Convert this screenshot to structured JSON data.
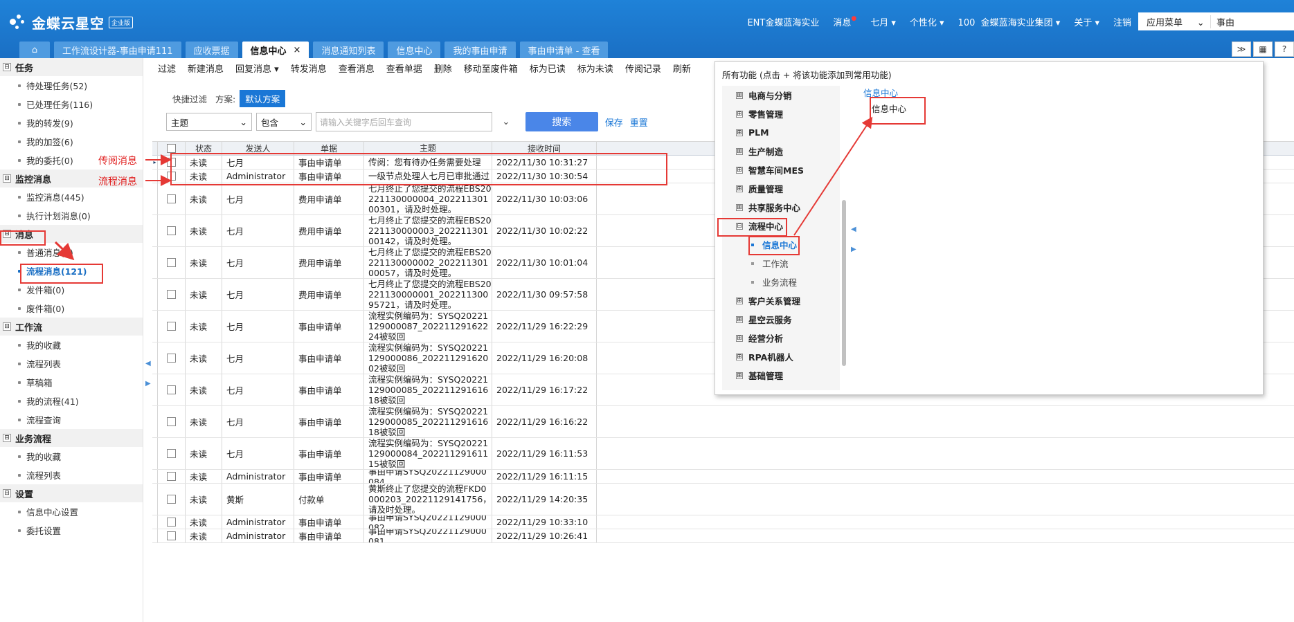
{
  "app": {
    "brand": "金蝶云星空",
    "edition": "企业版"
  },
  "topnav": {
    "org": "ENT金蝶蓝海实业",
    "messages": "消息",
    "user": "七月 ▾",
    "personalize": "个性化 ▾",
    "org_id": "100",
    "group": "金蝶蓝海实业集团 ▾",
    "about": "关于 ▾",
    "logout": "注销"
  },
  "appmenu": {
    "label": "应用菜单",
    "chevron": "⌄",
    "value": "事由"
  },
  "tabs": [
    "工作流设计器-事由申请111",
    "应收票据",
    "信息中心",
    "消息通知列表",
    "信息中心",
    "我的事由申请",
    "事由申请单 - 查看"
  ],
  "tab_close": "×",
  "icons": {
    "home": "home-icon",
    "collapse": "double-chevron-icon",
    "grid": "grid-icon",
    "help": "help-icon",
    "chevron": "chevron-down-icon"
  },
  "glyphs": {
    "collapse": "≫",
    "grid": "▦",
    "help": "?",
    "split_left": "◀",
    "split_right": "▶",
    "row_marker": "▸",
    "dbl_arrow": "⌄"
  },
  "sidebar": {
    "sections": [
      {
        "title": "任务",
        "toggle": "⊟",
        "items": [
          {
            "label": "待处理任务(52)"
          },
          {
            "label": "已处理任务(116)"
          },
          {
            "label": "我的转发(9)"
          },
          {
            "label": "我的加签(6)"
          },
          {
            "label": "我的委托(0)"
          }
        ]
      },
      {
        "title": "监控消息",
        "toggle": "⊟",
        "items": [
          {
            "label": "监控消息(445)"
          },
          {
            "label": "执行计划消息(0)"
          }
        ]
      },
      {
        "title": "消息",
        "toggle": "⊟",
        "items": [
          {
            "label": "普通消息(0)"
          },
          {
            "label": "流程消息(121)",
            "selected": true
          },
          {
            "label": "发件箱(0)"
          },
          {
            "label": "废件箱(0)"
          }
        ]
      },
      {
        "title": "工作流",
        "toggle": "⊟",
        "items": [
          {
            "label": "我的收藏"
          },
          {
            "label": "流程列表"
          },
          {
            "label": "草稿箱"
          },
          {
            "label": "我的流程(41)"
          },
          {
            "label": "流程查询"
          }
        ]
      },
      {
        "title": "业务流程",
        "toggle": "⊟",
        "items": [
          {
            "label": "我的收藏"
          },
          {
            "label": "流程列表"
          }
        ]
      },
      {
        "title": "设置",
        "toggle": "⊟",
        "items": [
          {
            "label": "信息中心设置"
          },
          {
            "label": "委托设置"
          }
        ]
      }
    ]
  },
  "annotations": {
    "forward_msg": "传阅消息",
    "flow_msg": "流程消息"
  },
  "toolbar": [
    "过滤",
    "新建消息",
    "回复消息 ▾",
    "转发消息",
    "查看消息",
    "查看单据",
    "删除",
    "移动至废件箱",
    "标为已读",
    "标为未读",
    "传阅记录",
    "刷新"
  ],
  "quick_filter": {
    "label": "快捷过滤",
    "scheme_label": "方案:",
    "scheme": "默认方案"
  },
  "filters": {
    "field": "主题",
    "op": "包含",
    "placeholder": "请输入关键字后回车查询",
    "search": "搜索",
    "save": "保存",
    "reset": "重置"
  },
  "grid": {
    "columns": [
      "状态",
      "发送人",
      "单据",
      "主题",
      "接收时间"
    ],
    "rows": [
      {
        "status": "未读",
        "sender": "七月",
        "doc": "事由申请单",
        "subject": "传阅：您有待办任务需要处理",
        "time": "2022/11/30 10:31:27",
        "h": 19,
        "marker": true
      },
      {
        "status": "未读",
        "sender": "Administrator",
        "doc": "事由申请单",
        "subject": "一级节点处理人七月已审批通过",
        "time": "2022/11/30 10:30:54",
        "h": 19
      },
      {
        "status": "未读",
        "sender": "七月",
        "doc": "费用申请单",
        "subject": "七月终止了您提交的流程EBS20221130000004_20221130100301，请及时处理。",
        "time": "2022/11/30 10:03:06",
        "h": 45
      },
      {
        "status": "未读",
        "sender": "七月",
        "doc": "费用申请单",
        "subject": "七月终止了您提交的流程EBS20221130000003_20221130100142，请及时处理。",
        "time": "2022/11/30 10:02:22",
        "h": 45
      },
      {
        "status": "未读",
        "sender": "七月",
        "doc": "费用申请单",
        "subject": "七月终止了您提交的流程EBS20221130000002_20221130100057，请及时处理。",
        "time": "2022/11/30 10:01:04",
        "h": 45
      },
      {
        "status": "未读",
        "sender": "七月",
        "doc": "费用申请单",
        "subject": "七月终止了您提交的流程EBS20221130000001_20221130095721，请及时处理。",
        "time": "2022/11/30 09:57:58",
        "h": 45
      },
      {
        "status": "未读",
        "sender": "七月",
        "doc": "事由申请单",
        "subject": "流程实例编码为：SYSQ20221129000087_20221129162224被驳回",
        "time": "2022/11/29 16:22:29",
        "h": 45
      },
      {
        "status": "未读",
        "sender": "七月",
        "doc": "事由申请单",
        "subject": "流程实例编码为：SYSQ20221129000086_20221129162002被驳回",
        "time": "2022/11/29 16:20:08",
        "h": 45
      },
      {
        "status": "未读",
        "sender": "七月",
        "doc": "事由申请单",
        "subject": "流程实例编码为：SYSQ20221129000085_20221129161618被驳回",
        "time": "2022/11/29 16:17:22",
        "h": 45
      },
      {
        "status": "未读",
        "sender": "七月",
        "doc": "事由申请单",
        "subject": "流程实例编码为：SYSQ20221129000085_20221129161618被驳回",
        "time": "2022/11/29 16:16:22",
        "h": 45
      },
      {
        "status": "未读",
        "sender": "七月",
        "doc": "事由申请单",
        "subject": "流程实例编码为：SYSQ20221129000084_20221129161115被驳回",
        "time": "2022/11/29 16:11:53",
        "h": 45
      },
      {
        "status": "未读",
        "sender": "Administrator",
        "doc": "事由申请单",
        "subject": "事由申请SYSQ20221129000084",
        "time": "2022/11/29 16:11:15",
        "h": 19
      },
      {
        "status": "未读",
        "sender": "黄斯",
        "doc": "付款单",
        "subject": "黄斯终止了您提交的流程FKD0000203_20221129141756，请及时处理。",
        "time": "2022/11/29 14:20:35",
        "h": 45
      },
      {
        "status": "未读",
        "sender": "Administrator",
        "doc": "事由申请单",
        "subject": "事由申请SYSQ20221129000082",
        "time": "2022/11/29 10:33:10",
        "h": 19
      },
      {
        "status": "未读",
        "sender": "Administrator",
        "doc": "事由申请单",
        "subject": "事由申请SYSQ20221129000081",
        "time": "2022/11/29 10:26:41",
        "h": 19
      }
    ]
  },
  "panel": {
    "title": "所有功能    (点击 + 将该功能添加到常用功能)",
    "tree": [
      {
        "label": "电商与分销",
        "toggle": "⊞"
      },
      {
        "label": "零售管理",
        "toggle": "⊞"
      },
      {
        "label": "PLM",
        "toggle": "⊞"
      },
      {
        "label": "生产制造",
        "toggle": "⊞"
      },
      {
        "label": "智慧车间MES",
        "toggle": "⊞"
      },
      {
        "label": "质量管理",
        "toggle": "⊞"
      },
      {
        "label": "共享服务中心",
        "toggle": "⊞"
      },
      {
        "label": "流程中心",
        "toggle": "⊟",
        "children": [
          {
            "label": "信息中心",
            "selected": true
          },
          {
            "label": "工作流"
          },
          {
            "label": "业务流程"
          }
        ]
      },
      {
        "label": "客户关系管理",
        "toggle": "⊞"
      },
      {
        "label": "星空云服务",
        "toggle": "⊞"
      },
      {
        "label": "经营分析",
        "toggle": "⊞"
      },
      {
        "label": "RPA机器人",
        "toggle": "⊞"
      },
      {
        "label": "基础管理",
        "toggle": "⊞"
      }
    ],
    "right_title": "信息中心",
    "right_item": "信息中心"
  }
}
